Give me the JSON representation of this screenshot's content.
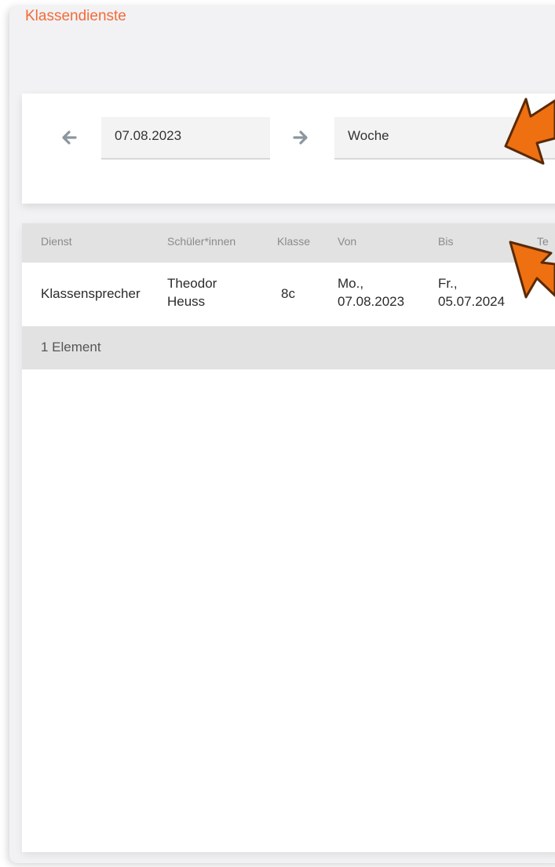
{
  "page": {
    "title": "Klassendienste"
  },
  "filter": {
    "date_value": "07.08.2023",
    "period_value": "Woche",
    "prev_icon": "arrow-left-icon",
    "next_icon": "arrow-right-icon"
  },
  "table": {
    "columns": [
      "Dienst",
      "Schüler*innen",
      "Klasse",
      "Von",
      "Bis",
      "Te"
    ],
    "rows": [
      {
        "dienst": "Klassensprecher",
        "schueler_line1": "Theodor",
        "schueler_line2": "Heuss",
        "klasse": "8c",
        "von_line1": "Mo.,",
        "von_line2": "07.08.2023",
        "bis_line1": "Fr.,",
        "bis_line2": "05.07.2024"
      }
    ],
    "footer": "1 Element"
  },
  "colors": {
    "accent": "#f26b3a",
    "callout_fill": "#ee7010",
    "callout_stroke": "#5a2a08",
    "header_bg": "#e2e2e2"
  },
  "annotations": [
    "arrow-callout-icon",
    "arrow-callout-icon"
  ]
}
